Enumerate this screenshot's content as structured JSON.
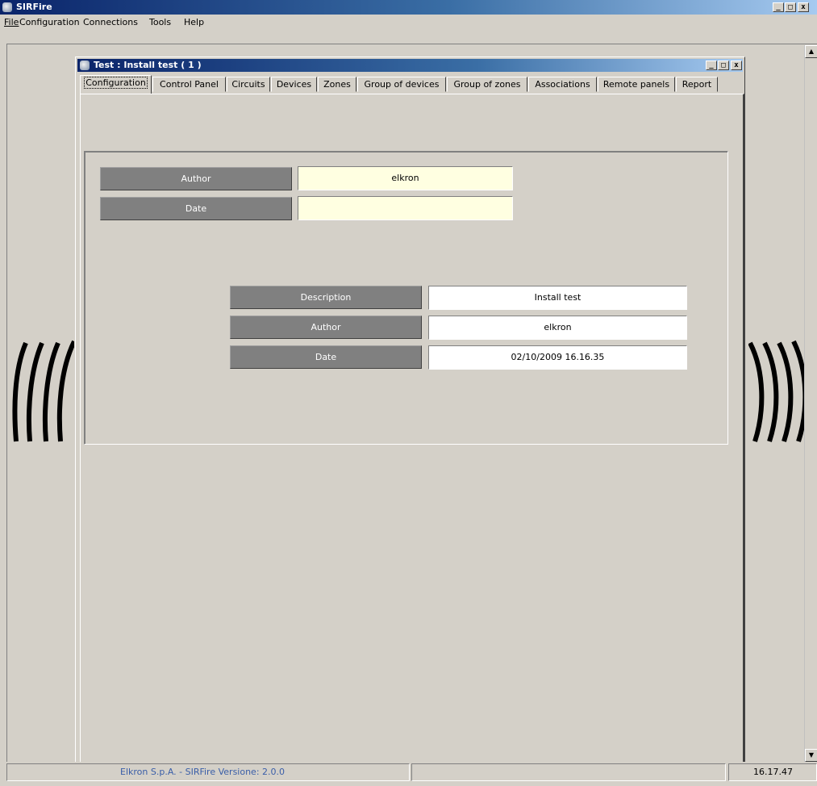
{
  "app": {
    "title": "SIRFire",
    "window_buttons": {
      "minimize": "_",
      "maximize": "□",
      "close": "x"
    }
  },
  "menu": [
    {
      "label": "File",
      "underline": "F"
    },
    {
      "label": "Configuration"
    },
    {
      "label": "Connections"
    },
    {
      "label": "Tools",
      "underline": "T"
    },
    {
      "label": "Help",
      "underline": "H"
    }
  ],
  "child_window": {
    "title": "Test : Install test  ( 1 )",
    "buttons": {
      "minimize": "_",
      "maximize": "□",
      "close": "x"
    },
    "tabs": [
      {
        "label": "Configuration",
        "active": true
      },
      {
        "label": "Control Panel"
      },
      {
        "label": "Circuits"
      },
      {
        "label": "Devices"
      },
      {
        "label": "Zones"
      },
      {
        "label": "Group of devices"
      },
      {
        "label": "Group of zones"
      },
      {
        "label": "Associations"
      },
      {
        "label": "Remote panels"
      },
      {
        "label": "Report"
      }
    ]
  },
  "config_panel": {
    "top_fields": [
      {
        "label": "Author",
        "value": "elkron"
      },
      {
        "label": "Date",
        "value": ""
      }
    ],
    "project_fields": [
      {
        "label": "Description",
        "value": "Install test"
      },
      {
        "label": "Author",
        "value": "elkron"
      },
      {
        "label": "Date",
        "value": "02/10/2009 16.16.35"
      }
    ]
  },
  "statusbar": {
    "info": "Elkron S.p.A.  -  SIRFire  Versione: 2.0.0",
    "clock": "16.17.47"
  },
  "colors": {
    "title_start": "#0a246a",
    "title_end": "#a6caf0",
    "label_bg": "#808080",
    "field_yellow": "#ffffe1",
    "window_bg": "#d4d0c8"
  }
}
